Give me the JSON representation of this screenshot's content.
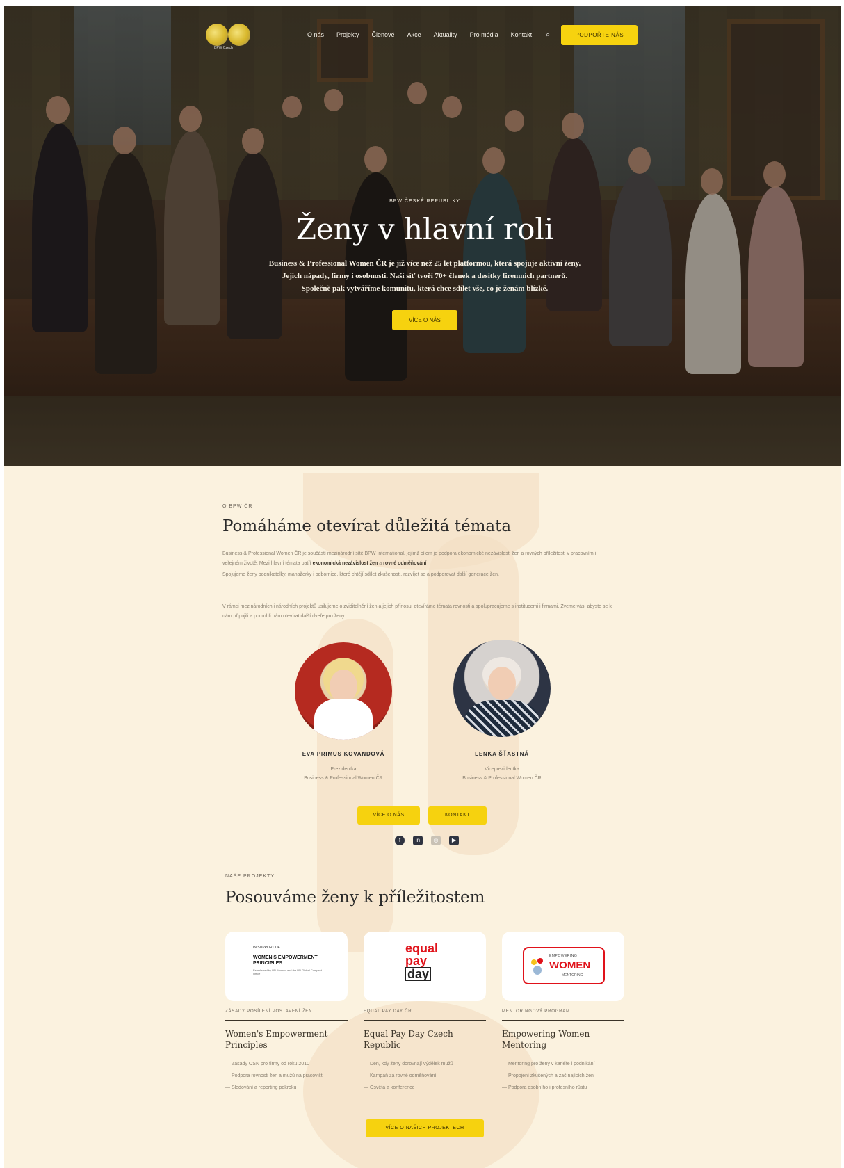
{
  "header": {
    "logo_text": "BPW Czech",
    "nav": [
      "O nás",
      "Projekty",
      "Členové",
      "Akce",
      "Aktuality",
      "Pro média",
      "Kontakt"
    ],
    "cta": "PODPOŘTE NÁS"
  },
  "hero": {
    "eyebrow": "BPW ČESKÉ REPUBLIKY",
    "title": "Ženy v hlavní roli",
    "description": "Business & Professional Women ČR je již více než 25 let platformou, která spojuje aktivní ženy. Jejich nápady, firmy i osobnosti. Naší síť tvoří 70+ členek a desítky firemních partnerů. Společně pak vytváříme komunitu, která chce sdílet vše, co je ženám blízké.",
    "button": "VÍCE O NÁS"
  },
  "about": {
    "label": "O BPW ČR",
    "title": "Pomáháme otevírat důležitá témata",
    "p1": "Business & Professional Women ČR je součástí mezinárodní sítě BPW International, jejímž cílem je podpora ekonomické nezávislosti žen a rovných příležitostí v pracovním i veřejném životě. Mezi hlavní témata patří ",
    "p1_bold": "ekonomická nezávislost žen",
    "p1b": " a ",
    "p1b_bold": "rovné odměňování",
    "p2": "Spojujeme ženy podnikatelky, manažerky i odbornice, které chtějí sdílet zkušenosti, rozvíjet se a podporovat další generace žen.",
    "p3": "V rámci mezinárodních i národních projektů usilujeme o zviditelnění žen a jejich přínosu, otevíráme témata rovnosti a spolupracujeme s institucemi i firmami. Zveme vás, abyste se k nám připojili a pomohli nám otevírat další dveře pro ženy."
  },
  "people": [
    {
      "name": "EVA PRIMUS KOVANDOVÁ",
      "role1": "Prezidentka",
      "role2": "Business & Professional Women ČR"
    },
    {
      "name": "LENKA ŠŤASTNÁ",
      "role1": "Viceprezidentka",
      "role2": "Business & Professional Women ČR"
    }
  ],
  "buttons": {
    "more": "VÍCE O NÁS",
    "contact": "KONTAKT"
  },
  "social": [
    "facebook-icon",
    "linkedin-icon",
    "instagram-icon",
    "youtube-icon"
  ],
  "projects": {
    "label": "NAŠE PROJEKTY",
    "title": "Posouváme ženy k příležitostem",
    "items": [
      {
        "label": "ZÁSADY POSÍLENÍ POSTAVENÍ ŽEN",
        "title": "Women's Empowerment Principles",
        "points": [
          "— Zásady OSN pro firmy od roku 2010",
          "— Podpora rovnosti žen a mužů na pracovišti",
          "— Sledování a reporting pokroku"
        ],
        "logo_top": "IN SUPPORT OF",
        "logo_main": "WOMEN'S EMPOWERMENT PRINCIPLES",
        "logo_sub": "Established by UN Women and the UN Global Compact Office"
      },
      {
        "label": "EQUAL PAY DAY ČR",
        "title": "Equal Pay Day Czech Republic",
        "points": [
          "— Den, kdy ženy dorovnají výdělek mužů",
          "— Kampaň za rovné odměňování",
          "— Osvěta a konference"
        ],
        "logo_l1": "equal",
        "logo_l2": "pay",
        "logo_l3": "day"
      },
      {
        "label": "MENTORINGOVÝ PROGRAM",
        "title": "Empowering Women Mentoring",
        "points": [
          "— Mentoring pro ženy v kariéře i podnikání",
          "— Propojení zkušených a začínajících žen",
          "— Podpora osobního i profesního růstu"
        ],
        "logo_t1": "EMPOWERING",
        "logo_t2": "WOMEN",
        "logo_t3": "MENTORING"
      }
    ],
    "button": "VÍCE O NAŠICH PROJEKTECH"
  }
}
